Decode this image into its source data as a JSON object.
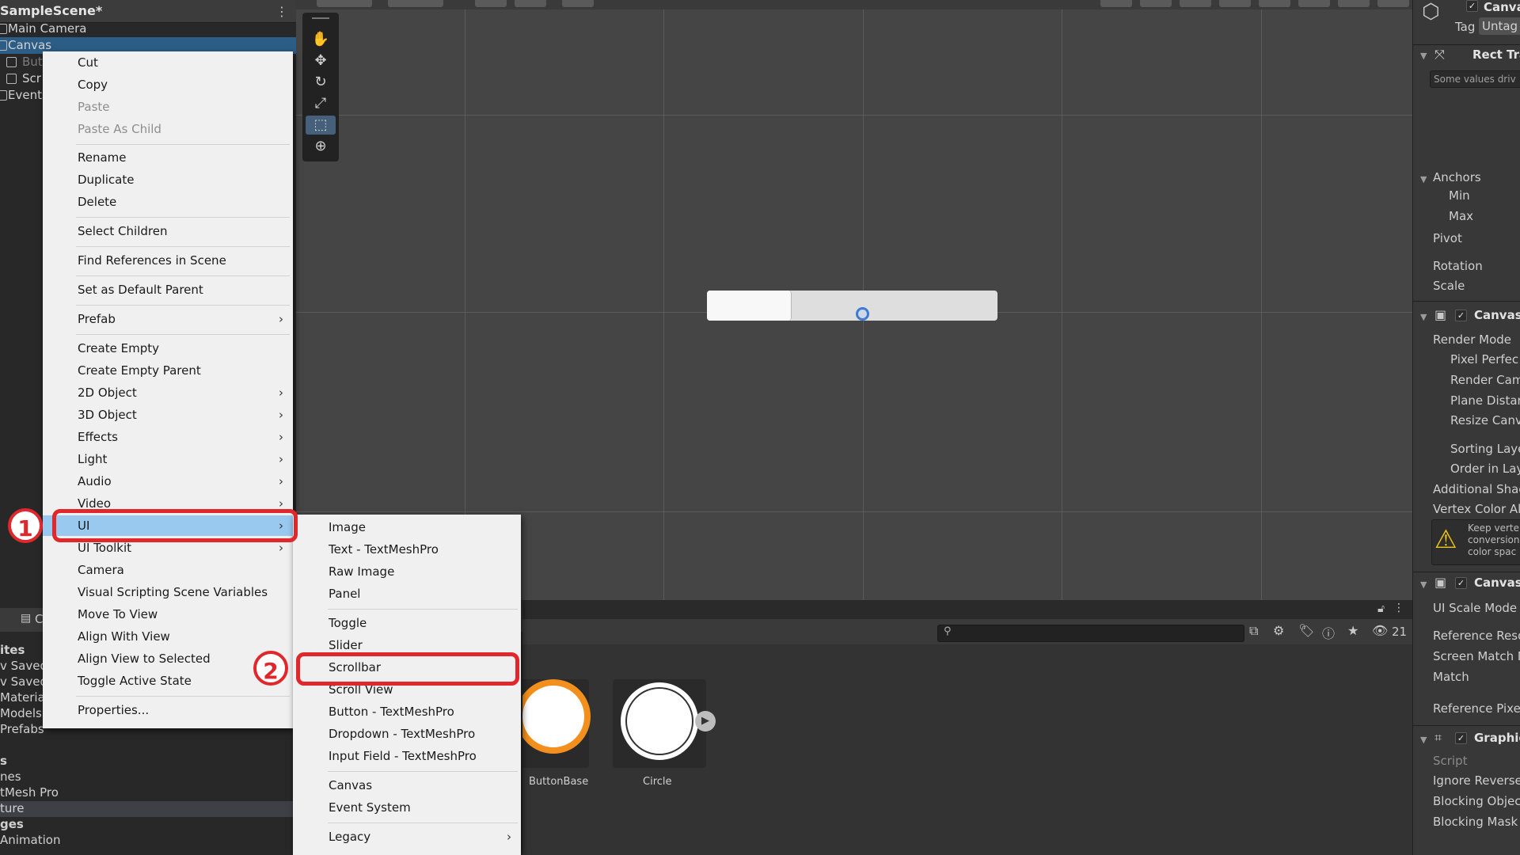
{
  "hierarchy": {
    "scene_title": "SampleScene*",
    "items": [
      {
        "label": "Main Camera"
      },
      {
        "label": "Canvas"
      },
      {
        "label": "But"
      },
      {
        "label": "Scr"
      },
      {
        "label": "Events"
      }
    ]
  },
  "project": {
    "tab_label": "C",
    "items": [
      {
        "label": "ites"
      },
      {
        "label": "v Saved"
      },
      {
        "label": "v Saved"
      },
      {
        "label": "Material"
      },
      {
        "label": "Models"
      },
      {
        "label": "Prefabs"
      },
      {
        "label": "s"
      },
      {
        "label": "nes"
      },
      {
        "label": "tMesh Pro"
      },
      {
        "label": "ture"
      },
      {
        "label": "ges"
      },
      {
        "label": "Animation"
      }
    ],
    "search_placeholder": "",
    "visible_count": "21",
    "assets": [
      {
        "label": "ButtonBase"
      },
      {
        "label": "Circle"
      }
    ]
  },
  "context_menu": {
    "items": [
      {
        "label": "Cut"
      },
      {
        "label": "Copy"
      },
      {
        "label": "Paste"
      },
      {
        "label": "Paste As Child"
      },
      {
        "label": "Rename"
      },
      {
        "label": "Duplicate"
      },
      {
        "label": "Delete"
      },
      {
        "label": "Select Children"
      },
      {
        "label": "Find References in Scene"
      },
      {
        "label": "Set as Default Parent"
      },
      {
        "label": "Prefab"
      },
      {
        "label": "Create Empty"
      },
      {
        "label": "Create Empty Parent"
      },
      {
        "label": "2D Object"
      },
      {
        "label": "3D Object"
      },
      {
        "label": "Effects"
      },
      {
        "label": "Light"
      },
      {
        "label": "Audio"
      },
      {
        "label": "Video"
      },
      {
        "label": "UI"
      },
      {
        "label": "UI Toolkit"
      },
      {
        "label": "Camera"
      },
      {
        "label": "Visual Scripting Scene Variables"
      },
      {
        "label": "Move To View"
      },
      {
        "label": "Align With View"
      },
      {
        "label": "Align View to Selected"
      },
      {
        "label": "Toggle Active State"
      },
      {
        "label": "Properties..."
      }
    ],
    "arrow_glyph": "›"
  },
  "ui_submenu": {
    "items": [
      {
        "label": "Image"
      },
      {
        "label": "Text - TextMeshPro"
      },
      {
        "label": "Raw Image"
      },
      {
        "label": "Panel"
      },
      {
        "label": "Toggle"
      },
      {
        "label": "Slider"
      },
      {
        "label": "Scrollbar"
      },
      {
        "label": "Scroll View"
      },
      {
        "label": "Button - TextMeshPro"
      },
      {
        "label": "Dropdown - TextMeshPro"
      },
      {
        "label": "Input Field - TextMeshPro"
      },
      {
        "label": "Canvas"
      },
      {
        "label": "Event System"
      },
      {
        "label": "Legacy"
      }
    ]
  },
  "callouts": [
    {
      "number": "1"
    },
    {
      "number": "2"
    }
  ],
  "inspector": {
    "object_name": "Canva",
    "tag_label": "Tag",
    "tag_value": "Untag",
    "rect_transform": "Rect Tra",
    "values_note": "Some values driv",
    "anchors": "Anchors",
    "min": "Min",
    "max": "Max",
    "pivot": "Pivot",
    "rotation": "Rotation",
    "scale": "Scale",
    "canvas_component": "Canvas",
    "render_mode": "Render Mode",
    "pixel_perfect": "Pixel Perfec",
    "render_camera": "Render Cam",
    "plane_distance": "Plane Distar",
    "resize_canvas": "Resize Canv",
    "sorting_layer": "Sorting Laye",
    "order_in_layer": "Order in Lay",
    "additional_shader": "Additional Shac",
    "vertex_color": "Vertex Color Alv",
    "warning_lines": [
      "Keep verte",
      "conversion",
      "color spac"
    ],
    "canvas_scaler": "Canvas",
    "ui_scale_mode": "UI Scale Mode",
    "reference_resolution": "Reference Reso",
    "screen_match": "Screen Match M",
    "match": "Match",
    "reference_pixels": "Reference Pixe",
    "graphic_raycaster": "Graphic",
    "script": "Script",
    "ignore_reversed": "Ignore Reverse",
    "blocking_objects": "Blocking Objec",
    "blocking_mask": "Blocking Mask"
  },
  "colors": {
    "menu_highlight": "#99c9ef",
    "callout_red": "#e0272c",
    "selection_blue": "#2c5d87",
    "orange_ring": "#f28f1d"
  }
}
